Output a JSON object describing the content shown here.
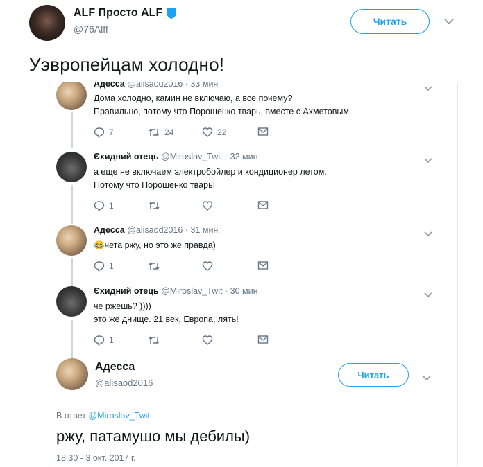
{
  "header": {
    "name": "ALF Просто ALF",
    "handle": "@76Alff",
    "follow_label": "Читать"
  },
  "tweet_text": "Уэвропейцам холодно!",
  "thread": {
    "replies": [
      {
        "name": "Адесса",
        "handle": "@alisaod2016",
        "time": "· 33 мин",
        "line1": "Дома холодно, камин не включаю, а все почему?",
        "line2": "Правильно, потому что Порошенко тварь, вместе с Ахметовым.",
        "replies": "7",
        "retweets": "24",
        "likes": "22"
      },
      {
        "name": "Єхидний отець",
        "handle": "@Miroslav_Twit",
        "time": "· 32 мин",
        "line1": "а еще не включаем электробойлер и кондиционер летом.",
        "line2": "Потому что Порошенко тварь!",
        "replies": "1",
        "retweets": "",
        "likes": ""
      },
      {
        "name": "Адесса",
        "handle": "@alisaod2016",
        "time": "· 31 мин",
        "line1": "😂чета ржу, но это же правда)",
        "line2": "",
        "replies": "1",
        "retweets": "",
        "likes": ""
      },
      {
        "name": "Єхидний отець",
        "handle": "@Miroslav_Twit",
        "time": "· 30 мин",
        "line1": "че ржешь? ))))",
        "line2": "это же днище. 21 век, Европа, лять!",
        "replies": "1",
        "retweets": "",
        "likes": ""
      }
    ],
    "main": {
      "name": "Адесса",
      "handle": "@alisaod2016",
      "follow_label": "Читать",
      "reply_prefix": "В ответ",
      "reply_to": "@Miroslav_Twit",
      "text": "ржу, патамушо мы дебилы)",
      "timestamp": "18:30 - 3 окт. 2017 г."
    }
  },
  "colors": {
    "accent": "#1da1f2",
    "verified": "#1da1f2",
    "muted": "#657786",
    "thread_line": "#ccd6dd"
  }
}
